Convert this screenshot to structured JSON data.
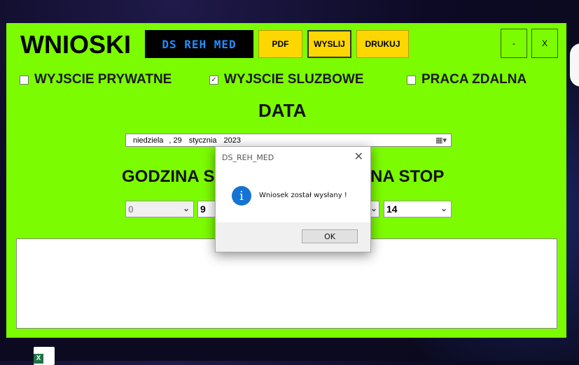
{
  "window": {
    "title": "WNIOSKI",
    "logo": "DS REH MED",
    "buttons": {
      "pdf": "PDF",
      "send": "WYSLIJ",
      "print": "DRUKUJ",
      "minimize": "-",
      "close": "X"
    }
  },
  "checkboxes": [
    {
      "label": "WYJSCIE PRYWATNE",
      "checked": false
    },
    {
      "label": "WYJSCIE SLUZBOWE",
      "checked": true
    },
    {
      "label": "PRACA ZDALNA",
      "checked": false
    }
  ],
  "date_section": {
    "heading": "DATA",
    "weekday": "niedziela",
    "day": "29",
    "month": "stycznia",
    "year": "2023"
  },
  "time_section": {
    "start_label_visible": "GODZINA S",
    "stop_label_visible": "NA STOP",
    "start_hour": "0",
    "start_minute": "9",
    "stop_minute": "14"
  },
  "dialog": {
    "title": "DS_REH_MED",
    "message": "Wniosek został wysłany !",
    "ok_label": "OK",
    "close_glyph": "✕",
    "info_glyph": "i"
  },
  "icons": {
    "dropdown": "chevron-down-icon",
    "calendar": "calendar-icon",
    "info": "info-icon"
  },
  "colors": {
    "app_background": "#7cfc00",
    "button_yellow": "#ffd700",
    "logo_text": "#1e8fff",
    "info_blue": "#1473d3"
  }
}
